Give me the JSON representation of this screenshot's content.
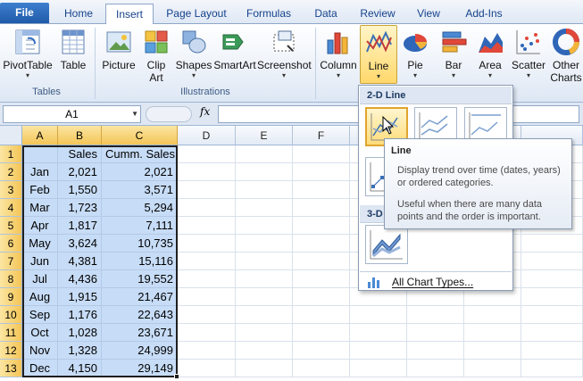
{
  "tabs": {
    "file": "File",
    "home": "Home",
    "insert": "Insert",
    "page_layout": "Page Layout",
    "formulas": "Formulas",
    "data": "Data",
    "review": "Review",
    "view": "View",
    "addins": "Add-Ins"
  },
  "ribbon": {
    "pivottable": "PivotTable",
    "table": "Table",
    "group_tables": "Tables",
    "picture": "Picture",
    "clip": "Clip",
    "art": "Art",
    "shapes": "Shapes",
    "smartart": "SmartArt",
    "screenshot": "Screenshot",
    "group_illustrations": "Illustrations",
    "column": "Column",
    "line": "Line",
    "pie": "Pie",
    "bar": "Bar",
    "area": "Area",
    "scatter": "Scatter",
    "other": "Other",
    "charts": "Charts"
  },
  "formula_bar": {
    "name_box": "A1",
    "fx": "fx",
    "formula": ""
  },
  "columns": [
    "A",
    "B",
    "C",
    "D",
    "E",
    "F"
  ],
  "rows": [
    "1",
    "2",
    "3",
    "4",
    "5",
    "6",
    "7",
    "8",
    "9",
    "10",
    "11",
    "12",
    "13"
  ],
  "sheet": {
    "header": [
      "",
      "Sales",
      "Cumm. Sales"
    ],
    "data": [
      [
        "Jan",
        "2,021",
        "2,021"
      ],
      [
        "Feb",
        "1,550",
        "3,571"
      ],
      [
        "Mar",
        "1,723",
        "5,294"
      ],
      [
        "Apr",
        "1,817",
        "7,111"
      ],
      [
        "May",
        "3,624",
        "10,735"
      ],
      [
        "Jun",
        "4,381",
        "15,116"
      ],
      [
        "Jul",
        "4,436",
        "19,552"
      ],
      [
        "Aug",
        "1,915",
        "21,467"
      ],
      [
        "Sep",
        "1,176",
        "22,643"
      ],
      [
        "Oct",
        "1,028",
        "23,671"
      ],
      [
        "Nov",
        "1,328",
        "24,999"
      ],
      [
        "Dec",
        "4,150",
        "29,149"
      ]
    ]
  },
  "dropdown": {
    "section_2d": "2-D Line",
    "section_3d": "3-D",
    "all_chart_types": "All Chart Types..."
  },
  "tooltip": {
    "title": "Line",
    "p1": "Display trend over time (dates, years) or ordered categories.",
    "p2": "Useful when there are many data points and the order is important."
  }
}
